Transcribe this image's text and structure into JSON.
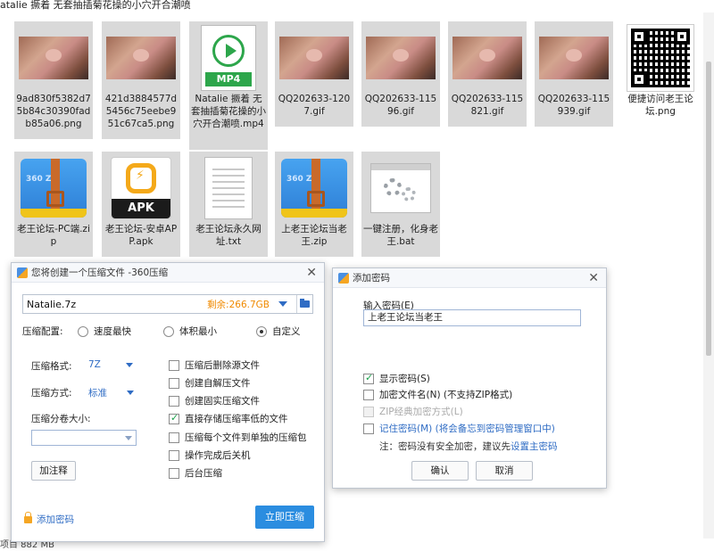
{
  "window": {
    "title": "atalie 撅着 无套抽插菊花操的小穴开合潮喷"
  },
  "status": {
    "text": "项目 882 MB"
  },
  "files": [
    {
      "name": "9ad830f5382d75b84c30390fadb85a06.png",
      "kind": "photo"
    },
    {
      "name": "421d3884577d5456c75eebe951c67ca5.png",
      "kind": "photo"
    },
    {
      "name": "Natalie 撅着 无套抽插菊花操的小穴开合潮喷.mp4",
      "kind": "mp4",
      "badge": "MP4"
    },
    {
      "name": "QQ202633-1207.gif",
      "kind": "photo"
    },
    {
      "name": "QQ202633-11596.gif",
      "kind": "photo"
    },
    {
      "name": "QQ202633-115821.gif",
      "kind": "photo"
    },
    {
      "name": "QQ202633-115939.gif",
      "kind": "photo"
    },
    {
      "name": "便捷访问老王论坛.png",
      "kind": "qr"
    },
    {
      "name": "老王论坛-PC端.zip",
      "kind": "zip360",
      "badge": "360 ZIP"
    },
    {
      "name": "老王论坛-安卓APP.apk",
      "kind": "apk",
      "badge": "APK"
    },
    {
      "name": "老王论坛永久网址.txt",
      "kind": "txt"
    },
    {
      "name": "上老王论坛当老王.zip",
      "kind": "zip360",
      "badge": "360 ZIP"
    },
    {
      "name": "一键注册，化身老王.bat",
      "kind": "bat"
    }
  ],
  "compress_dialog": {
    "title": "您将创建一个压缩文件 -360压缩",
    "filename": "Natalie.7z",
    "free_space": "剩余:266.7GB",
    "config_label": "压缩配置:",
    "modes": [
      {
        "label": "速度最快",
        "selected": false
      },
      {
        "label": "体积最小",
        "selected": false
      },
      {
        "label": "自定义",
        "selected": true
      }
    ],
    "format_label": "压缩格式:",
    "format_value": "7Z",
    "method_label": "压缩方式:",
    "method_value": "标准",
    "split_label": "压缩分卷大小:",
    "split_value": "",
    "comment_button": "加注释",
    "options": [
      {
        "label": "压缩后删除源文件",
        "checked": false
      },
      {
        "label": "创建自解压文件",
        "checked": false
      },
      {
        "label": "创建固实压缩文件",
        "checked": false
      },
      {
        "label": "直接存储压缩率低的文件",
        "checked": true
      },
      {
        "label": "压缩每个文件到单独的压缩包",
        "checked": false
      },
      {
        "label": "操作完成后关机",
        "checked": false
      },
      {
        "label": "后台压缩",
        "checked": false
      }
    ],
    "add_password": "添加密码",
    "start_button": "立即压缩"
  },
  "password_dialog": {
    "title": "添加密码",
    "input_label": "输入密码(E)",
    "password_value": "上老王论坛当老王",
    "show_password": "显示密码(S)",
    "encrypt_names": "加密文件名(N) (不支持ZIP格式)",
    "zip_classic": "ZIP经典加密方式(L)",
    "remember": "记住密码(M)",
    "remember_note": "(将会备忘到密码管理窗口中)",
    "note_prefix": "注：密码没有安全加密，建议先",
    "note_link": "设置主密码",
    "ok_button": "确认",
    "cancel_button": "取消"
  }
}
